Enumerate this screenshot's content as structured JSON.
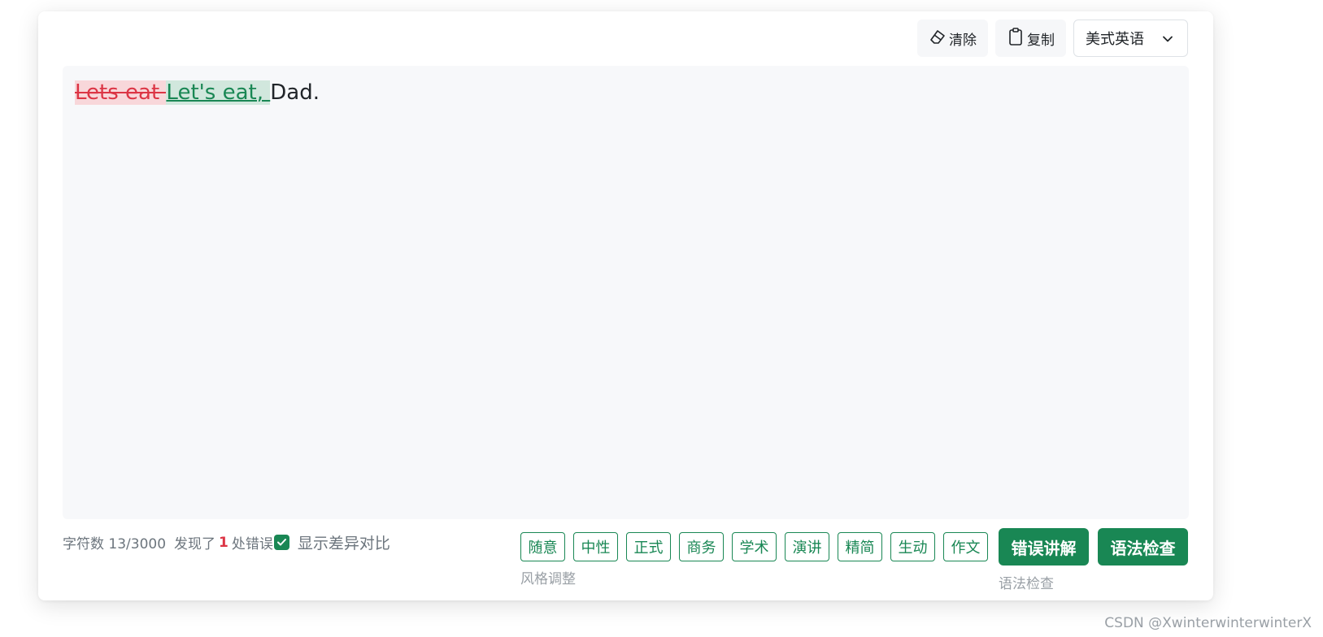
{
  "toolbar": {
    "clear_label": "清除",
    "copy_label": "复制",
    "language_selected": "美式英语"
  },
  "editor": {
    "deleted_text": "Lets eat ",
    "inserted_text": "Let's eat, ",
    "plain_text": "Dad."
  },
  "status": {
    "char_count": "字符数 13/3000",
    "found_prefix": "发现了",
    "error_count": "1",
    "found_suffix": "处错误",
    "show_diff_label": "显示差异对比",
    "show_diff_checked": true
  },
  "style": {
    "tags": [
      "随意",
      "中性",
      "正式",
      "商务",
      "学术",
      "演讲",
      "精简",
      "生动",
      "作文"
    ],
    "caption": "风格调整"
  },
  "actions": {
    "explain_label": "错误讲解",
    "grammar_label": "语法检查",
    "caption": "语法检查"
  },
  "watermark": "CSDN @XwinterwinterwinterX",
  "colors": {
    "accent": "#198754",
    "error": "#dc3545",
    "deleted_bg": "#f8d7da",
    "inserted_bg": "#d1e7dd",
    "editor_bg": "#f7f8fa"
  }
}
